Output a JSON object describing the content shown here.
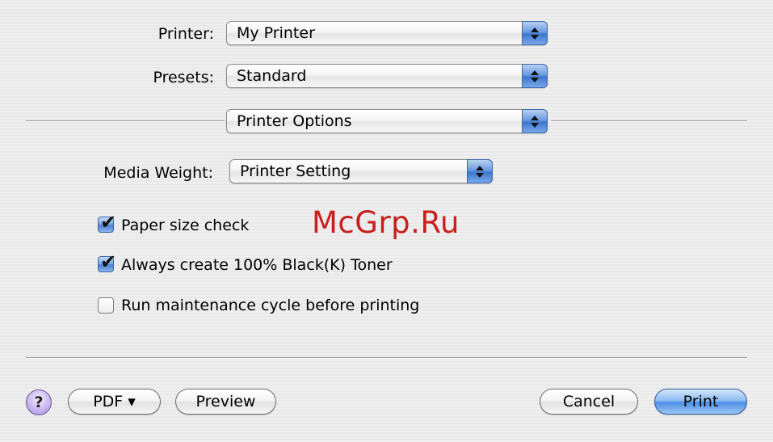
{
  "printer": {
    "label": "Printer:",
    "value": "My Printer"
  },
  "presets": {
    "label": "Presets:",
    "value": "Standard"
  },
  "pane": {
    "value": "Printer Options"
  },
  "media_weight": {
    "label": "Media Weight:",
    "value": "Printer Setting"
  },
  "options": [
    {
      "label": "Paper size check",
      "checked": true
    },
    {
      "label": "Always create 100% Black(K) Toner",
      "checked": true
    },
    {
      "label": "Run maintenance cycle before printing",
      "checked": false
    }
  ],
  "watermark": "McGrp.Ru",
  "footer": {
    "help_label": "?",
    "pdf_label": "PDF ▾",
    "preview_label": "Preview",
    "cancel_label": "Cancel",
    "print_label": "Print"
  },
  "colors": {
    "accent_blue": "#4e8ee3",
    "watermark_red": "#c81e1e",
    "help_purple": "#c9b6f0"
  }
}
